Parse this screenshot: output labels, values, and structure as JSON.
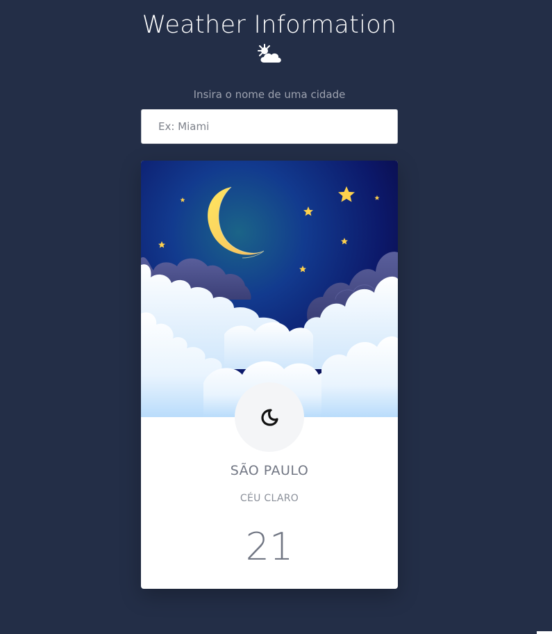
{
  "header": {
    "title": "Weather Information",
    "title_icon": "partly-cloudy-icon"
  },
  "search": {
    "label": "Insira o nome de uma cidade",
    "placeholder": "Ex: Miami",
    "value": ""
  },
  "weather_card": {
    "scene": "night-sky-with-moon-stars-clouds",
    "condition_icon": "moon-icon",
    "city": "SÃO PAULO",
    "description": "CÉU CLARO",
    "temperature": "21"
  },
  "colors": {
    "background": "#232e47",
    "card": "#ffffff",
    "sky_dark": "#0b0f4f",
    "sky_glow": "#1a5a8a",
    "moon": "#fcd861",
    "text_muted": "#717683"
  }
}
